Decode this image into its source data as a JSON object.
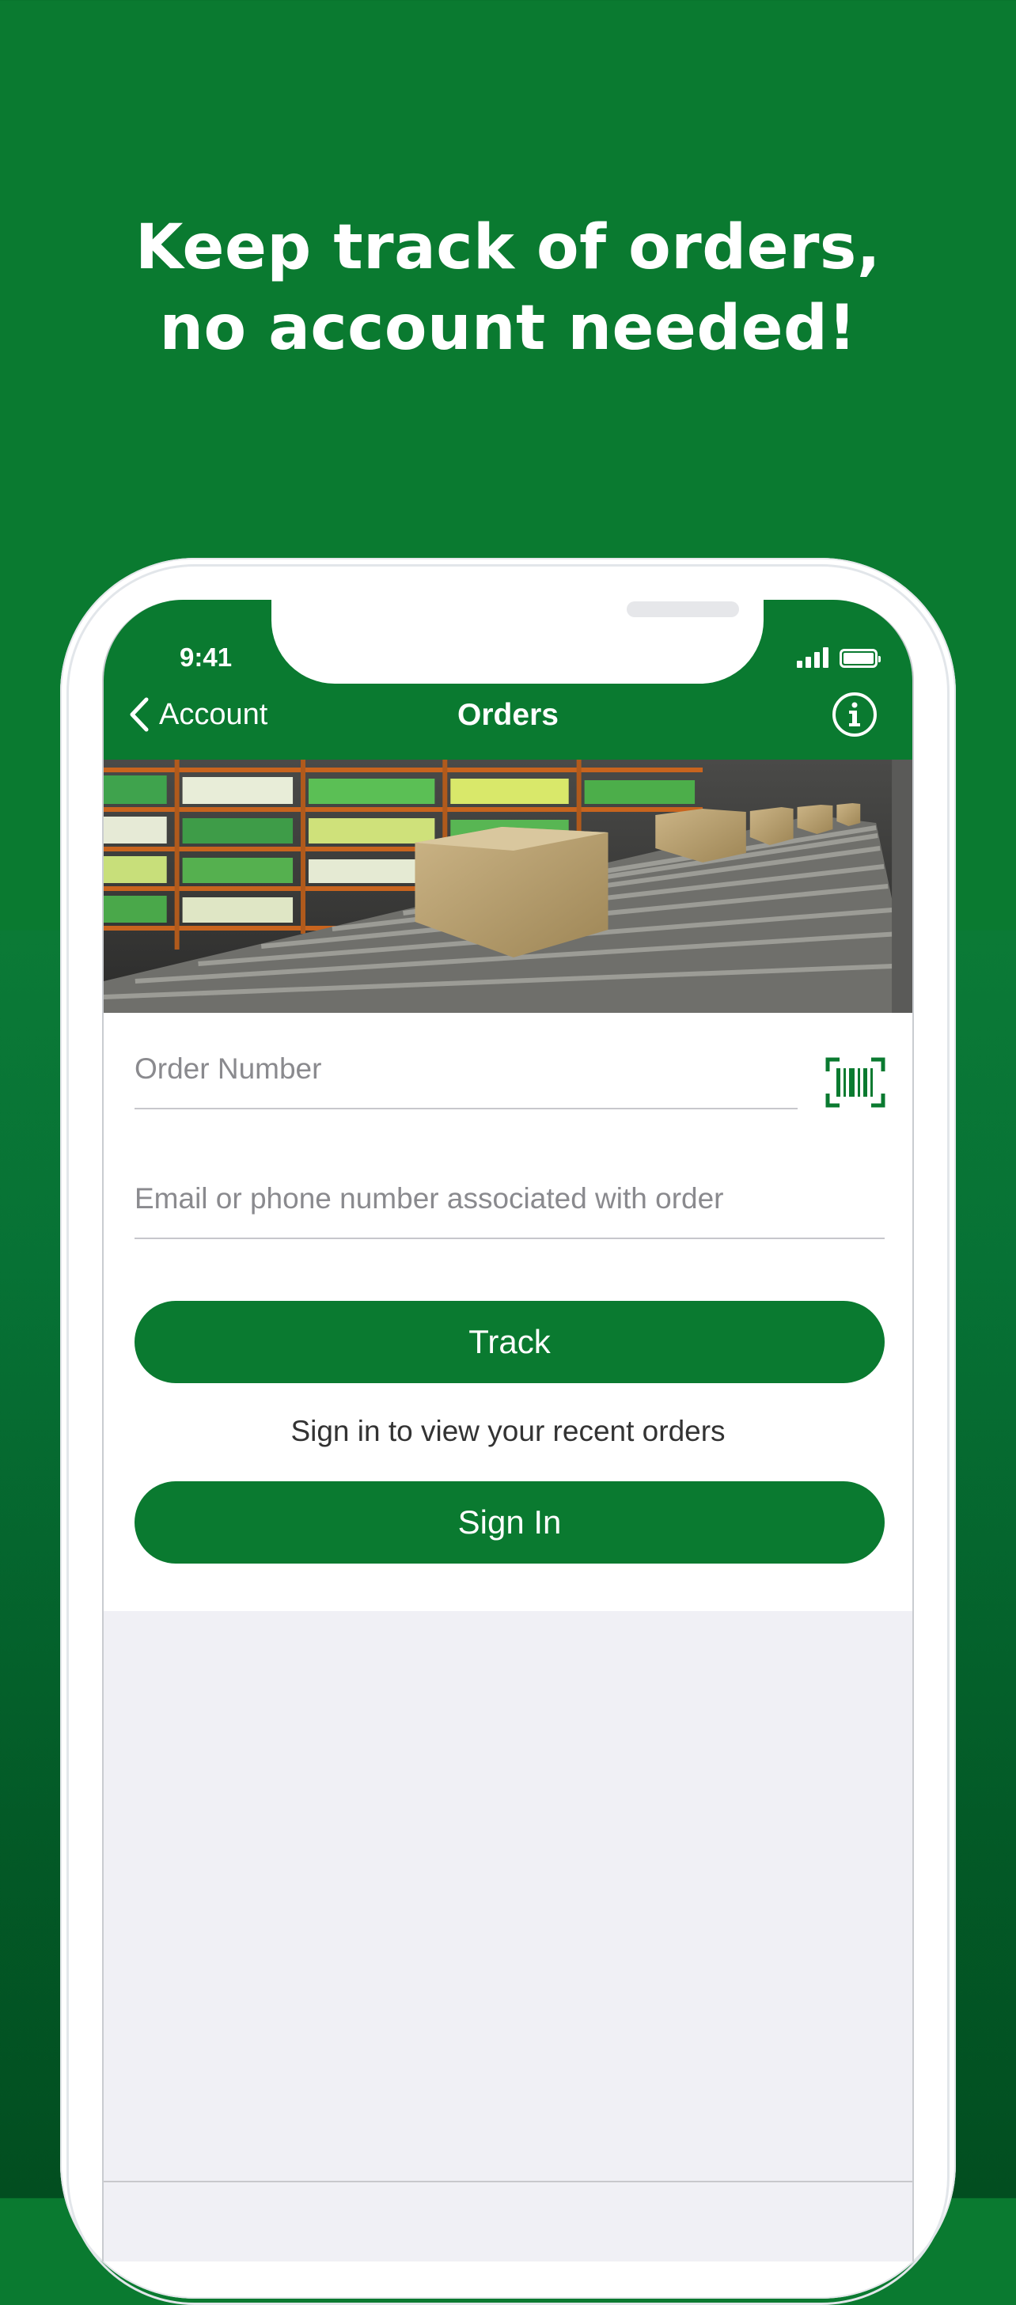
{
  "headline": {
    "line1": "Keep track of orders,",
    "line2": "no account needed!"
  },
  "status_bar": {
    "time": "9:41"
  },
  "nav": {
    "back_label": "Account",
    "title": "Orders"
  },
  "form": {
    "order_number_placeholder": "Order Number",
    "contact_placeholder": "Email or phone number associated with order",
    "track_label": "Track",
    "signin_prompt": "Sign in to view your recent orders",
    "signin_label": "Sign In"
  },
  "colors": {
    "brand_green": "#0a7a30",
    "background_dark_green": "#024e20",
    "grey_panel": "#f0f0f5"
  },
  "icons": {
    "back": "chevron-left-icon",
    "info": "info-icon",
    "barcode": "barcode-scan-icon",
    "signal": "cellular-signal-icon",
    "battery": "battery-icon"
  }
}
